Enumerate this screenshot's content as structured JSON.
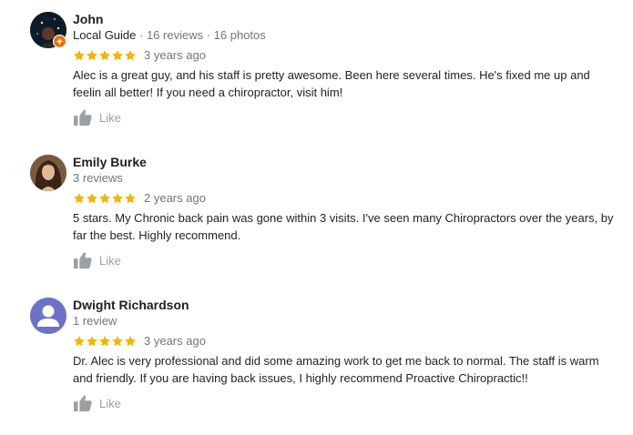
{
  "reviews": [
    {
      "name": "John",
      "local_guide": "Local Guide",
      "meta": "16 reviews · 16 photos",
      "rating": 5,
      "date": "3 years ago",
      "text": "Alec is a great guy, and his staff is pretty awesome. Been here several times. He's fixed me up and feelin all better! If you need a chiropractor, visit him!",
      "like_label": "Like"
    },
    {
      "name": "Emily Burke",
      "meta": "3 reviews",
      "rating": 5,
      "date": "2 years ago",
      "text": "5 stars.  My Chronic back pain was gone within 3 visits. I've seen many Chiropractors over the years, by far the best. Highly recommend.",
      "like_label": "Like"
    },
    {
      "name": "Dwight Richardson",
      "meta": "1 review",
      "rating": 5,
      "date": "3 years ago",
      "text": "Dr. Alec is very professional and did some amazing work to get me back to normal. The staff is warm and friendly. If you are having back issues, I highly recommend Proactive Chiropractic!!",
      "like_label": "Like"
    }
  ],
  "colors": {
    "star": "#f4b400",
    "like_icon": "#9aa0a6",
    "guide_badge": "#e8710a",
    "default_avatar": "#6c72c4"
  }
}
